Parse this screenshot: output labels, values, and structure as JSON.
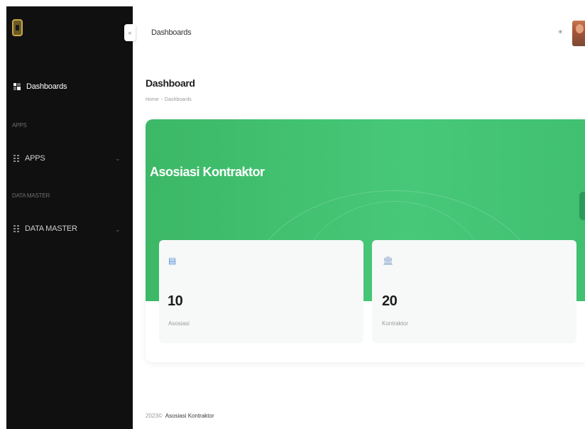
{
  "sidebar": {
    "dashboard_label": "Dashboards",
    "sections": {
      "apps_label": "APPS",
      "master_label": "DATA MASTER"
    },
    "items": {
      "apps": "APPS",
      "master": "DATA MASTER"
    },
    "collapse_icon": "«"
  },
  "header": {
    "title": "Dashboards",
    "icon": "☀"
  },
  "page": {
    "title": "Dashboard",
    "breadcrumb_home": "Home",
    "breadcrumb_sep": "-",
    "breadcrumb_current": "Dashboards"
  },
  "hero": {
    "title": "Asosiasi Kontraktor"
  },
  "stats": [
    {
      "value": "10",
      "label": "Asosiasi",
      "icon": "▤"
    },
    {
      "value": "20",
      "label": "Kontraktor",
      "icon": "🏛"
    }
  ],
  "footer": {
    "year": "2023©",
    "text": "Asosiasi Kontraktor"
  },
  "colors": {
    "sidebar_bg": "#101010",
    "accent_green": "#45c474",
    "icon_blue": "#5b8fd8"
  }
}
